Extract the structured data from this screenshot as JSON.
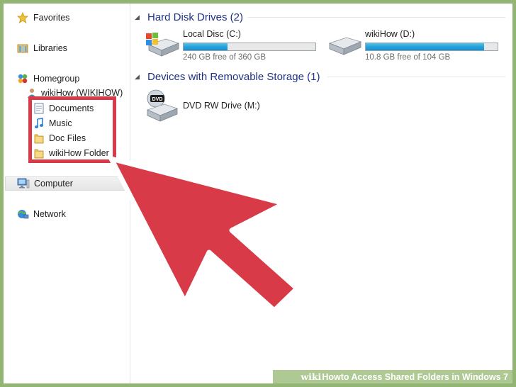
{
  "sidebar": {
    "favorites": {
      "label": "Favorites",
      "icon": "star-icon"
    },
    "libraries": {
      "label": "Libraries",
      "icon": "library-icon"
    },
    "homegroup": {
      "label": "Homegroup",
      "icon": "homegroup-icon"
    },
    "user": {
      "label": "wikiHow (WIKIHOW)",
      "icon": "user-icon"
    },
    "shared_items": [
      {
        "label": "Documents",
        "icon": "document-icon"
      },
      {
        "label": "Music",
        "icon": "music-icon"
      },
      {
        "label": "Doc Files",
        "icon": "folder-icon"
      },
      {
        "label": "wikiHow Folder",
        "icon": "folder-icon"
      }
    ],
    "computer": {
      "label": "Computer",
      "icon": "computer-icon"
    },
    "network": {
      "label": "Network",
      "icon": "network-icon"
    }
  },
  "sections": {
    "hdd": {
      "title": "Hard Disk Drives (2)"
    },
    "removable": {
      "title": "Devices with Removable Storage (1)"
    }
  },
  "drives": [
    {
      "name": "Local Disc (C:)",
      "free": "240 GB free of 360 GB",
      "used_fraction": 0.333,
      "icon": "windows-hard-drive-icon"
    },
    {
      "name": "wikiHow (D:)",
      "free": "10.8 GB free of 104 GB",
      "used_fraction": 0.896,
      "icon": "hard-drive-icon"
    }
  ],
  "removable": [
    {
      "name": "DVD RW Drive (M:)",
      "icon": "dvd-drive-icon"
    }
  ],
  "colors": {
    "accent": "#d83a48",
    "section_title": "#1e3287",
    "bar_fill": "#26a0da",
    "border": "#93b574"
  },
  "footer": {
    "brand_wiki": "wiki",
    "brand_how": "How",
    "title": " to Access Shared Folders in Windows 7"
  }
}
